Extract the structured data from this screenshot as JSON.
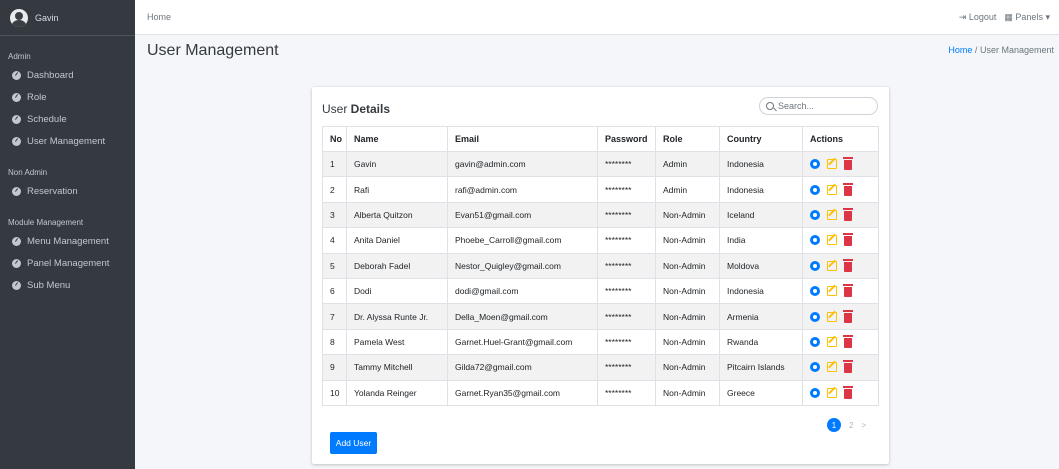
{
  "sidebar": {
    "user_name": "Gavin",
    "sections": [
      {
        "label": "Admin",
        "items": [
          "Dashboard",
          "Role",
          "Schedule",
          "User Management"
        ]
      },
      {
        "label": "Non Admin",
        "items": [
          "Reservation"
        ]
      },
      {
        "label": "Module Management",
        "items": [
          "Menu Management",
          "Panel Management",
          "Sub Menu"
        ]
      }
    ]
  },
  "topbar": {
    "home": "Home",
    "logout": "Logout",
    "panels": "Panels",
    "panels_caret": "▾"
  },
  "page": {
    "title": "User Management",
    "breadcrumb_home": "Home",
    "breadcrumb_sep": "/",
    "breadcrumb_current": "User Management"
  },
  "card": {
    "title_prefix": "User ",
    "title_bold": "Details",
    "search_placeholder": "Search...",
    "columns": [
      "No",
      "Name",
      "Email",
      "Password",
      "Role",
      "Country",
      "Actions"
    ],
    "rows": [
      [
        "1",
        "Gavin",
        "gavin@admin.com",
        "********",
        "Admin",
        "Indonesia"
      ],
      [
        "2",
        "Rafi",
        "rafi@admin.com",
        "********",
        "Admin",
        "Indonesia"
      ],
      [
        "3",
        "Alberta Quitzon",
        "Evan51@gmail.com",
        "********",
        "Non-Admin",
        "Iceland"
      ],
      [
        "4",
        "Anita Daniel",
        "Phoebe_Carroll@gmail.com",
        "********",
        "Non-Admin",
        "India"
      ],
      [
        "5",
        "Deborah Fadel",
        "Nestor_Quigley@gmail.com",
        "********",
        "Non-Admin",
        "Moldova"
      ],
      [
        "6",
        "Dodi",
        "dodi@gmail.com",
        "********",
        "Non-Admin",
        "Indonesia"
      ],
      [
        "7",
        "Dr. Alyssa Runte Jr.",
        "Della_Moen@gmail.com",
        "********",
        "Non-Admin",
        "Armenia"
      ],
      [
        "8",
        "Pamela West",
        "Garnet.Huel-Grant@gmail.com",
        "********",
        "Non-Admin",
        "Rwanda"
      ],
      [
        "9",
        "Tammy Mitchell",
        "Gilda72@gmail.com",
        "********",
        "Non-Admin",
        "Pitcairn Islands"
      ],
      [
        "10",
        "Yolanda Reinger",
        "Garnet.Ryan35@gmail.com",
        "********",
        "Non-Admin",
        "Greece"
      ]
    ],
    "pagination": {
      "current": "1",
      "next_page": "2",
      "next_arrow": ">"
    },
    "add_button": "Add User"
  },
  "colors": {
    "primary": "#007bff",
    "warning": "#ffc107",
    "danger": "#dc3545",
    "sidebar": "#343a40"
  }
}
